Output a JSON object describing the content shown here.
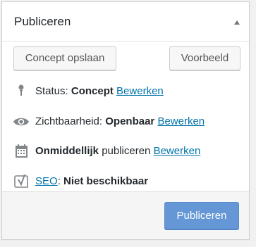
{
  "panel": {
    "title": "Publiceren",
    "toggle_icon": "triangle-up-icon"
  },
  "actions": {
    "save_draft_label": "Concept opslaan",
    "preview_label": "Voorbeeld"
  },
  "status": {
    "icon": "pin-icon",
    "label": "Status:",
    "value": "Concept",
    "edit_label": "Bewerken"
  },
  "visibility": {
    "icon": "eye-icon",
    "label": "Zichtbaarheid:",
    "value": "Openbaar",
    "edit_label": "Bewerken"
  },
  "schedule": {
    "icon": "calendar-icon",
    "value": "Onmiddellijk",
    "label": "publiceren",
    "edit_label": "Bewerken"
  },
  "seo": {
    "icon": "yoast-icon",
    "link_label": "SEO",
    "separator": ":",
    "value": "Niet beschikbaar"
  },
  "footer": {
    "publish_label": "Publiceren"
  },
  "colors": {
    "link": "#0073aa",
    "primary_button": "#6596d6",
    "icon": "#82878c"
  }
}
